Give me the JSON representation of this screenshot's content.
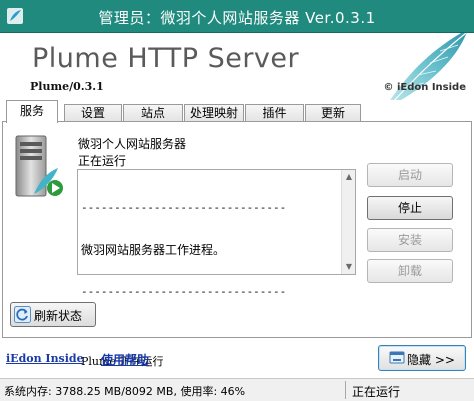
{
  "window": {
    "title": "管理员：微羽个人网站服务器 Ver.0.3.1"
  },
  "banner": {
    "brand": "Plume HTTP Server",
    "version": "Plume/0.3.1",
    "copyright": "© iEdon Inside"
  },
  "tabs": [
    {
      "label": "服务",
      "active": true
    },
    {
      "label": "设置",
      "active": false
    },
    {
      "label": "站点",
      "active": false
    },
    {
      "label": "处理映射",
      "active": false
    },
    {
      "label": "插件",
      "active": false
    },
    {
      "label": "更新",
      "active": false
    }
  ],
  "service": {
    "name": "微羽个人网站服务器",
    "status": "正在运行",
    "log": [
      "-------------------------------",
      "微羽网站服务器工作进程。",
      "-------------------------------",
      "",
      "Plume 正在运行"
    ]
  },
  "actions": {
    "start": {
      "label": "启动",
      "enabled": false
    },
    "stop": {
      "label": "停止",
      "enabled": true
    },
    "install": {
      "label": "安装",
      "enabled": false
    },
    "uninstall": {
      "label": "卸载",
      "enabled": false
    }
  },
  "refresh_label": "刷新状态",
  "footer": {
    "link1": "iEdon Inside",
    "link2": "使用帮助",
    "hide_label": "隐藏 >>"
  },
  "statusbar": {
    "memory": "系统内存: 3788.25 MB/8092 MB, 使用率: 46%",
    "state": "正在运行"
  },
  "colors": {
    "titlebar": "#1f8a7d",
    "link": "#1a3aa8"
  }
}
